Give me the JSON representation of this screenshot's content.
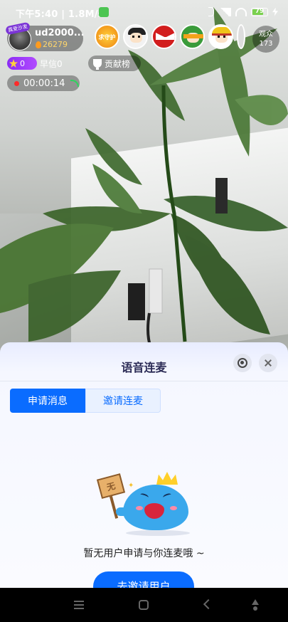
{
  "status_bar": {
    "time": "下午5:40 | 1.8M/s",
    "battery": "79",
    "battery_percent": 79
  },
  "host": {
    "badge": "真爱沙发",
    "name": "ud2000...",
    "fans": "26279"
  },
  "viewers": {
    "guard_label": "求守护",
    "audience_label": "观众",
    "audience_count": "173"
  },
  "stats": {
    "level": "0",
    "zaoxin": "早信0",
    "contrib_label": "贡献榜",
    "timer": "00:00:14"
  },
  "panel": {
    "title": "语音连麦",
    "tabs": [
      {
        "label": "申请消息",
        "active": true
      },
      {
        "label": "邀请连麦",
        "active": false
      }
    ],
    "sign_text": "无",
    "empty_text": "暂无用户申请与你连麦哦 ~",
    "invite_button": "去邀请用户"
  },
  "colors": {
    "accent": "#0a6cff",
    "panel_bg": "#f5f7ff",
    "level_purple": "#8b2cf5",
    "rec_red": "#ff2a2a"
  },
  "icons": [
    "bluetooth-icon",
    "signal-icon",
    "wifi-icon",
    "battery-icon",
    "flame-icon",
    "star-icon",
    "trophy-icon",
    "record-dot-icon",
    "signal-wave-icon",
    "gear-icon",
    "close-icon",
    "menu-icon",
    "home-icon",
    "back-icon"
  ]
}
